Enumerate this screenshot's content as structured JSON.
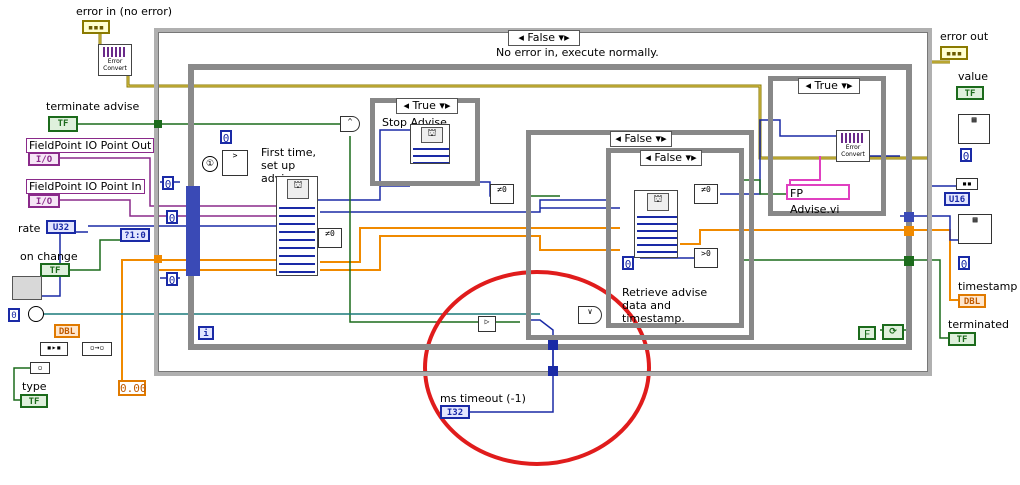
{
  "labels": {
    "error_in": "error in (no error)",
    "error_out": "error out",
    "terminate_advise": "terminate advise",
    "fp_out": "FieldPoint IO Point Out",
    "fp_in": "FieldPoint IO Point In",
    "rate": "rate",
    "on_change": "on change",
    "type": "type",
    "value": "value",
    "timestamp": "timestamp",
    "terminated": "terminated",
    "ms_timeout": "ms timeout (-1)"
  },
  "comments": {
    "no_error": "No error in, execute normally.",
    "first_time": "First time, set up advise.",
    "stop_advise": "Stop Advise",
    "retrieve": "Retrieve advise data and timestamp."
  },
  "case_selectors": {
    "outer": "False",
    "stop": "True",
    "retrieve_outer": "False",
    "retrieve_inner": "False",
    "right": "True"
  },
  "terminals": {
    "tf": "TF",
    "io": "I/O",
    "u32": "U32",
    "i32": "I32",
    "dbl": "DBL",
    "u16": "U16"
  },
  "constants": {
    "zero": "0",
    "dbl_zero": "0.00",
    "false_const": "F",
    "loop_index": "i",
    "ring": "?1:0"
  },
  "subvi_names": {
    "error_convert": "Error Convert",
    "fp_advise": "FP Advise.vi"
  },
  "colors": {
    "bool_wire": "#1c6b1c",
    "int_wire": "#1a2aa6",
    "dbl_wire": "#f08a00",
    "error_wire": "#8a7a00",
    "io_wire": "#8a2a8a",
    "annotation": "#e01c1c"
  }
}
